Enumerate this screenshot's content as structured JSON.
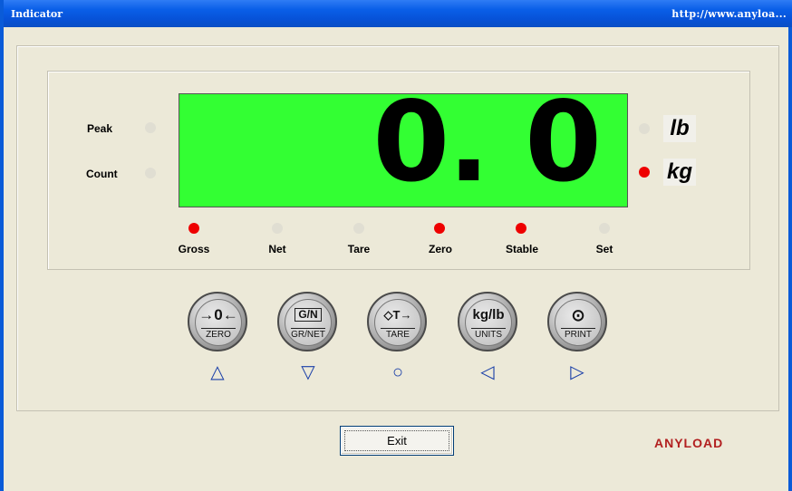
{
  "window": {
    "title": "Indicator",
    "url": "http://www.anyloa..."
  },
  "display": {
    "reading": "0. 0"
  },
  "side_indicators": [
    {
      "label": "Peak",
      "state": "off"
    },
    {
      "label": "Count",
      "state": "off"
    }
  ],
  "units": [
    {
      "label": "lb",
      "state": "off"
    },
    {
      "label": "kg",
      "state": "on"
    }
  ],
  "status_indicators": [
    {
      "label": "Gross",
      "state": "on"
    },
    {
      "label": "Net",
      "state": "off"
    },
    {
      "label": "Tare",
      "state": "off"
    },
    {
      "label": "Zero",
      "state": "on"
    },
    {
      "label": "Stable",
      "state": "on"
    },
    {
      "label": "Set",
      "state": "off"
    }
  ],
  "keys": [
    {
      "symbol": "→0←",
      "label": "ZERO",
      "icon": "zero-icon",
      "arrow": "△"
    },
    {
      "symbol": "G/N",
      "label": "GR/NET",
      "icon": "gross-net-icon",
      "arrow": "▽"
    },
    {
      "symbol": "◇T→",
      "label": "TARE",
      "icon": "tare-icon",
      "arrow": "○"
    },
    {
      "symbol": "kg/lb",
      "label": "UNITS",
      "icon": "units-icon",
      "arrow": "◁"
    },
    {
      "symbol": "⊙",
      "label": "PRINT",
      "icon": "print-icon",
      "arrow": "▷"
    }
  ],
  "exit_label": "Exit",
  "logo": "ANYLOAD",
  "colors": {
    "display_bg": "#33ff33",
    "led_on": "#ee0000",
    "led_off": "#e0ded2",
    "title_bar": "#0a5fe8"
  }
}
